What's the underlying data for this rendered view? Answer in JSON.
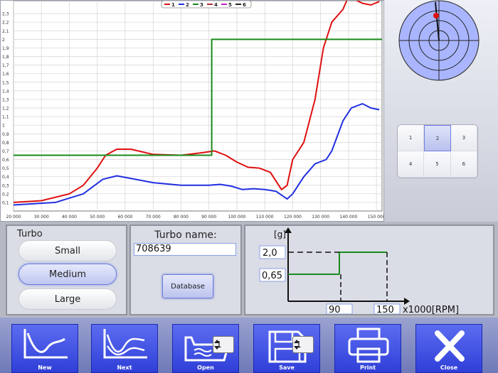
{
  "chart_data": {
    "type": "line",
    "title": "",
    "xlabel": "",
    "ylabel": "",
    "xlim": [
      20000,
      152000
    ],
    "ylim": [
      0,
      2.45
    ],
    "x_ticks": [
      "20 000",
      "30 000",
      "40 000",
      "50 000",
      "60 000",
      "70 000",
      "80 000",
      "90 000",
      "100 000",
      "110 000",
      "120 000",
      "130 000",
      "140 000",
      "150 000"
    ],
    "y_ticks": [
      "0,1",
      "0,2",
      "0,3",
      "0,4",
      "0,5",
      "0,6",
      "0,7",
      "0,8",
      "0,9",
      "1",
      "1,1",
      "1,2",
      "1,3",
      "1,4",
      "1,5",
      "1,6",
      "1,7",
      "1,8",
      "1,9",
      "2",
      "2,1",
      "2,2",
      "2,3"
    ],
    "grid": true,
    "legend": [
      "1",
      "2",
      "3",
      "4",
      "5",
      "6"
    ],
    "legend_position": "top-center",
    "series": [
      {
        "name": "1",
        "color": "#e01010",
        "points": [
          [
            20000,
            0.1
          ],
          [
            30000,
            0.12
          ],
          [
            40000,
            0.2
          ],
          [
            45000,
            0.3
          ],
          [
            50000,
            0.5
          ],
          [
            53000,
            0.65
          ],
          [
            57000,
            0.72
          ],
          [
            62000,
            0.72
          ],
          [
            70000,
            0.66
          ],
          [
            80000,
            0.65
          ],
          [
            88000,
            0.68
          ],
          [
            92000,
            0.7
          ],
          [
            96000,
            0.65
          ],
          [
            100000,
            0.57
          ],
          [
            104000,
            0.51
          ],
          [
            108000,
            0.5
          ],
          [
            112000,
            0.45
          ],
          [
            116000,
            0.25
          ],
          [
            118000,
            0.3
          ],
          [
            120000,
            0.6
          ],
          [
            122000,
            0.7
          ],
          [
            124000,
            0.8
          ],
          [
            128000,
            1.3
          ],
          [
            131000,
            1.9
          ],
          [
            134000,
            2.2
          ],
          [
            138000,
            2.35
          ],
          [
            140000,
            2.5
          ],
          [
            145000,
            2.42
          ],
          [
            148000,
            2.4
          ],
          [
            151000,
            2.44
          ]
        ]
      },
      {
        "name": "2",
        "color": "#2030e0",
        "points": [
          [
            20000,
            0.07
          ],
          [
            35000,
            0.1
          ],
          [
            45000,
            0.2
          ],
          [
            52000,
            0.37
          ],
          [
            57000,
            0.41
          ],
          [
            62000,
            0.38
          ],
          [
            70000,
            0.33
          ],
          [
            80000,
            0.3
          ],
          [
            90000,
            0.3
          ],
          [
            94000,
            0.31
          ],
          [
            98000,
            0.29
          ],
          [
            102000,
            0.25
          ],
          [
            106000,
            0.26
          ],
          [
            110000,
            0.25
          ],
          [
            114000,
            0.23
          ],
          [
            118000,
            0.14
          ],
          [
            120000,
            0.2
          ],
          [
            124000,
            0.4
          ],
          [
            128000,
            0.55
          ],
          [
            132000,
            0.6
          ],
          [
            134000,
            0.7
          ],
          [
            138000,
            1.05
          ],
          [
            141000,
            1.2
          ],
          [
            145000,
            1.25
          ],
          [
            148000,
            1.2
          ],
          [
            151000,
            1.18
          ]
        ]
      },
      {
        "name": "3",
        "color": "#1a8a1a",
        "points": [
          [
            20000,
            0.65
          ],
          [
            91000,
            0.65
          ],
          [
            91000,
            2.0
          ],
          [
            152000,
            2.0
          ]
        ]
      }
    ]
  },
  "radar": {
    "needle_color": "#111111",
    "dot_color": "#e01010"
  },
  "keypad": {
    "keys": [
      "1",
      "2",
      "3",
      "4",
      "5",
      "6"
    ],
    "selected": "2"
  },
  "turbo": {
    "legend": "Turbo",
    "options": [
      {
        "label": "Small",
        "selected": false
      },
      {
        "label": "Medium",
        "selected": true
      },
      {
        "label": "Large",
        "selected": false
      }
    ]
  },
  "turbo_name": {
    "title": "Turbo name:",
    "value": "708639",
    "database_label": "Database"
  },
  "profile": {
    "unit_label": "[g]",
    "y_values": [
      "2,0",
      "0,65"
    ],
    "x_values": [
      "90",
      "150"
    ],
    "x_unit": "x1000[RPM]"
  },
  "toolbar": {
    "buttons": [
      {
        "label": "New",
        "icon": "line-chart-icon"
      },
      {
        "label": "Next",
        "icon": "multi-line-chart-icon"
      },
      {
        "label": "Open",
        "icon": "open-folder-icon",
        "counter": "1"
      },
      {
        "label": "Save",
        "icon": "floppy-disk-icon",
        "counter": "1"
      },
      {
        "label": "Print",
        "icon": "printer-icon"
      },
      {
        "label": "Close",
        "icon": "close-x-icon"
      }
    ]
  }
}
